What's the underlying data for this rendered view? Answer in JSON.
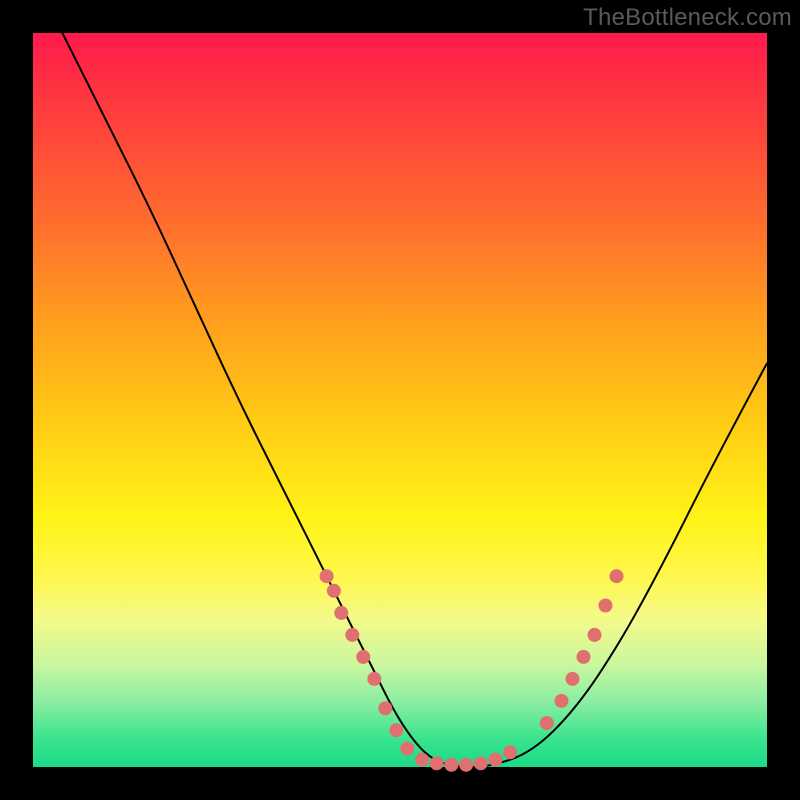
{
  "watermark": "TheBottleneck.com",
  "colors": {
    "page_bg": "#000000",
    "curve_stroke": "#000000",
    "marker_fill": "#e07070",
    "marker_stroke": "#c85a5a"
  },
  "chart_data": {
    "type": "line",
    "title": "",
    "xlabel": "",
    "ylabel": "",
    "xlim": [
      0,
      100
    ],
    "ylim": [
      0,
      100
    ],
    "grid": false,
    "background_gradient": "rainbow-vertical (red→orange→yellow→green)",
    "series": [
      {
        "name": "bottleneck-curve",
        "note": "V-shaped curve; y≈0 near the bottom; values are % from top-left origin approximation",
        "x": [
          4,
          10,
          16,
          22,
          28,
          34,
          40,
          46,
          50,
          54,
          58,
          62,
          68,
          74,
          80,
          86,
          92,
          100
        ],
        "y": [
          100,
          88,
          76,
          63,
          50,
          38,
          26,
          14,
          6,
          1,
          0,
          0,
          2,
          8,
          17,
          28,
          40,
          55
        ]
      }
    ],
    "markers": {
      "name": "highlighted-points",
      "note": "salmon dots along lower portion of curve",
      "points": [
        {
          "x": 40,
          "y": 26
        },
        {
          "x": 41,
          "y": 24
        },
        {
          "x": 42,
          "y": 21
        },
        {
          "x": 43.5,
          "y": 18
        },
        {
          "x": 45,
          "y": 15
        },
        {
          "x": 46.5,
          "y": 12
        },
        {
          "x": 48,
          "y": 8
        },
        {
          "x": 49.5,
          "y": 5
        },
        {
          "x": 51,
          "y": 2.5
        },
        {
          "x": 53,
          "y": 1
        },
        {
          "x": 55,
          "y": 0.5
        },
        {
          "x": 57,
          "y": 0.3
        },
        {
          "x": 59,
          "y": 0.3
        },
        {
          "x": 61,
          "y": 0.5
        },
        {
          "x": 63,
          "y": 1
        },
        {
          "x": 65,
          "y": 2
        },
        {
          "x": 70,
          "y": 6
        },
        {
          "x": 72,
          "y": 9
        },
        {
          "x": 73.5,
          "y": 12
        },
        {
          "x": 75,
          "y": 15
        },
        {
          "x": 76.5,
          "y": 18
        },
        {
          "x": 78,
          "y": 22
        },
        {
          "x": 79.5,
          "y": 26
        }
      ]
    }
  }
}
